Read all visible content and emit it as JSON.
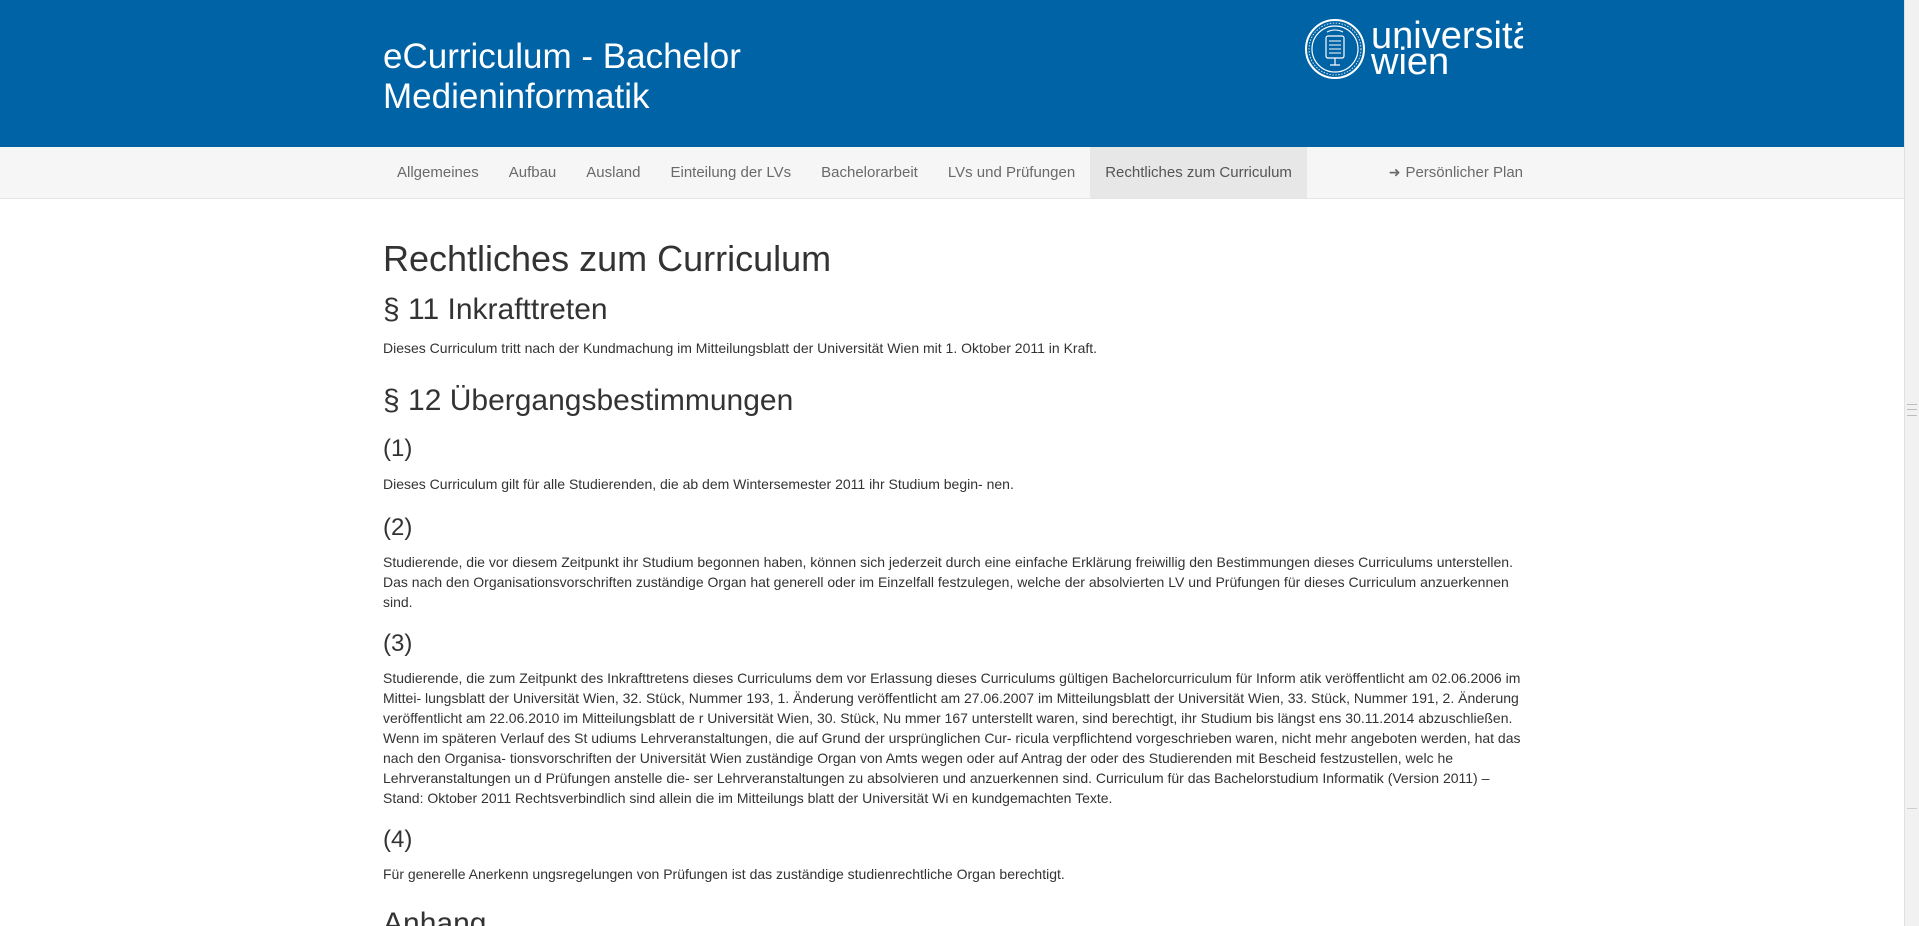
{
  "header": {
    "title": "eCurriculum - Bachelor Medieninformatik",
    "logo_text_line1": "universität",
    "logo_text_line2": "wien",
    "background_color": "#0063a6"
  },
  "nav": {
    "items": [
      {
        "label": "Allgemeines",
        "active": false
      },
      {
        "label": "Aufbau",
        "active": false
      },
      {
        "label": "Ausland",
        "active": false
      },
      {
        "label": "Einteilung der LVs",
        "active": false
      },
      {
        "label": "Bachelorarbeit",
        "active": false
      },
      {
        "label": "LVs und Prüfungen",
        "active": false
      },
      {
        "label": "Rechtliches zum Curriculum",
        "active": true
      }
    ],
    "right_item": {
      "label": "Persönlicher Plan",
      "icon": "arrow-right-icon"
    }
  },
  "content": {
    "page_title": "Rechtliches zum Curriculum",
    "s11": {
      "heading": "§ 11 Inkrafttreten",
      "text": "Dieses Curriculum tritt nach der Kundmachung im Mitteilungsblatt der Universität Wien mit 1. Oktober 2011 in Kraft."
    },
    "s12": {
      "heading": "§ 12 Übergangsbestimmungen",
      "paragraphs": [
        {
          "num": "(1)",
          "text": "Dieses Curriculum gilt für alle Studierenden, die ab dem Wintersemester 2011 ihr Studium begin- nen."
        },
        {
          "num": "(2)",
          "text": "Studierende, die vor diesem Zeitpunkt ihr Studium begonnen haben, können sich jederzeit durch eine einfache Erklärung freiwillig den Bestimmungen dieses Curriculums unterstellen. Das nach den Organisationsvorschriften zuständige Organ hat generell oder im Einzelfall festzulegen, welche der absolvierten LV und Prüfungen für dieses Curriculum anzuerkennen sind."
        },
        {
          "num": "(3)",
          "text": "Studierende, die zum Zeitpunkt des Inkrafttretens dieses Curriculums dem vor Erlassung dieses Curriculums gültigen Bachelorcurriculum für Inform atik veröffentlicht am 02.06.2006 im Mittei- lungsblatt der Universität Wien, 32. Stück, Nummer 193, 1. Änderung veröffentlicht am 27.06.2007 im Mitteilungsblatt der Universität Wien, 33. Stück, Nummer 191, 2. Änderung veröffentlicht am 22.06.2010 im Mitteilungsblatt de r Universität Wien, 30. Stück, Nu mmer 167 unterstellt waren, sind berechtigt, ihr Studium bis längst ens 30.11.2014 abzuschließen. Wenn im späteren Verlauf des St udiums Lehrveranstaltungen, die auf Grund der ursprünglichen Cur- ricula verpflichtend vorgeschrieben waren, nicht mehr angeboten werden, hat das nach den Organisa- tionsvorschriften der Universität Wien zuständige Organ von Amts wegen oder auf Antrag der oder des Studierenden mit Bescheid festzustellen, welc he Lehrveranstaltungen un d Prüfungen anstelle die- ser Lehrveranstaltungen zu absolvieren und anzuerkennen sind. Curriculum für das Bachelorstudium Informatik (Version 2011) – Stand: Oktober 2011 Rechtsverbindlich sind allein die im Mitteilungs blatt der Universität Wi en kundgemachten Texte."
        },
        {
          "num": "(4)",
          "text": "Für generelle Anerkenn ungsregelungen von Prüfungen ist das zuständige studienrechtliche Organ berechtigt."
        }
      ]
    },
    "anhang_heading": "Anhang"
  }
}
